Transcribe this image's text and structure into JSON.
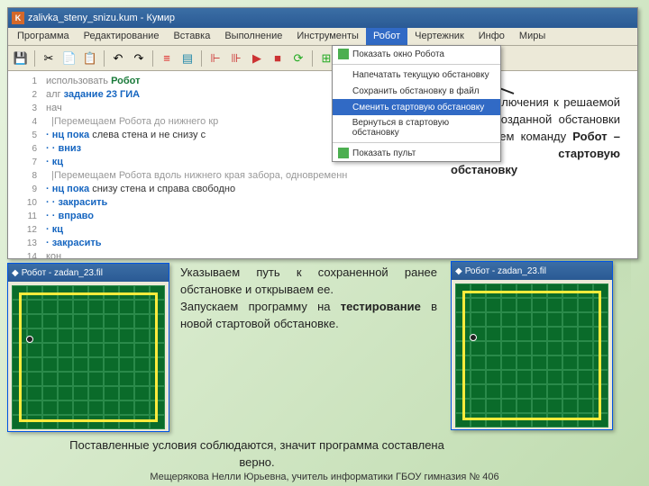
{
  "window": {
    "title": "zalivka_steny_snizu.kum - Кумир",
    "icon_letter": "K"
  },
  "menu": {
    "items": [
      "Программа",
      "Редактирование",
      "Вставка",
      "Выполнение",
      "Инструменты",
      "Робот",
      "Чертежник",
      "Инфо",
      "Миры"
    ],
    "active_index": 5
  },
  "dropdown": {
    "items": [
      "Показать окно Робота",
      "Напечатать текущую обстановку",
      "Сохранить обстановку в файл",
      "Сменить стартовую обстановку",
      "Вернуться в стартовую обстановку",
      "Показать пульт"
    ],
    "highlight_index": 3
  },
  "code": {
    "lines": [
      {
        "n": "1",
        "html": "<span class='kw-use'>использовать</span> <span class='kw-robot'>Робот</span>"
      },
      {
        "n": "2",
        "html": "<span class='kw-alg'>алг</span> <span class='kw-name'>задание 23 ГИА</span>"
      },
      {
        "n": "3",
        "html": "<span class='kw-nach'>нач</span>"
      },
      {
        "n": "4",
        "html": "<span class='kw-comment'>  |Перемещаем Робота до нижнего кр</span>"
      },
      {
        "n": "5",
        "html": "<span class='kw-cmd'>· нц пока</span> <span class='kw-cond'>слева стена и не снизу с</span>"
      },
      {
        "n": "6",
        "html": "<span class='kw-cmd'>· · вниз</span>"
      },
      {
        "n": "7",
        "html": "<span class='kw-cmd'>· кц</span>"
      },
      {
        "n": "8",
        "html": "<span class='kw-comment'>  |Перемещаем Робота вдоль нижнего края забора, одновременн</span>"
      },
      {
        "n": "9",
        "html": "<span class='kw-cmd'>· нц пока</span> <span class='kw-cond'>снизу стена и справа свободно</span>"
      },
      {
        "n": "10",
        "html": "<span class='kw-cmd'>· · закрасить</span>"
      },
      {
        "n": "11",
        "html": "<span class='kw-cmd'>· · вправо</span>"
      },
      {
        "n": "12",
        "html": "<span class='kw-cmd'>· кц</span>"
      },
      {
        "n": "13",
        "html": "<span class='kw-cmd'>· закрасить</span>"
      },
      {
        "n": "14",
        "html": "<span class='kw-nach'>кон</span>"
      }
    ]
  },
  "robot_windows": {
    "title1": "Робот - zadan_23.fil",
    "title2": "Робот - zadan_23.fil"
  },
  "texts": {
    "t1_html": "Указываем путь к сохраненной ранее обстановке и открываем ее.<br>Запускаем программу на <b>тестирование</b> в новой стартовой обстановке.",
    "t2_html": "Для подключения к решаемой задаче созданной обстановки используем команду <b>Робот – Сменить стартовую обстановку</b>",
    "t3_html": "Поставленные условия соблюдаются, значит программа составлена верно.",
    "footer": "Мещерякова Нелли Юрьевна, учитель информатики ГБОУ гимназия № 406"
  }
}
